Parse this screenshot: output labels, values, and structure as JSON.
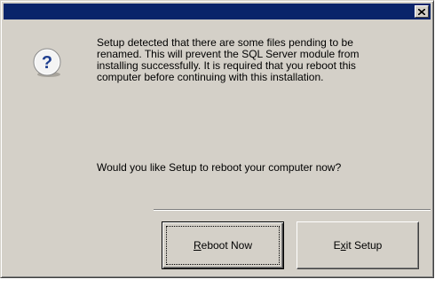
{
  "dialog": {
    "close_glyph": "×",
    "icon": "question-icon",
    "message": "Setup detected that there are some files pending to be\nrenamed. This will prevent the SQL Server module from\ninstalling successfully. It is required that you reboot this\ncomputer before continuing with this installation.",
    "prompt": "Would you like Setup to reboot your computer now?"
  },
  "buttons": {
    "reboot": {
      "mnemonic": "R",
      "label_rest": "eboot Now"
    },
    "exit": {
      "label_before": "E",
      "mnemonic": "x",
      "label_after": "it Setup"
    }
  },
  "colors": {
    "titlebar": "#0a246a",
    "face": "#d4d0c8",
    "icon_blue": "#1f3f8f"
  }
}
